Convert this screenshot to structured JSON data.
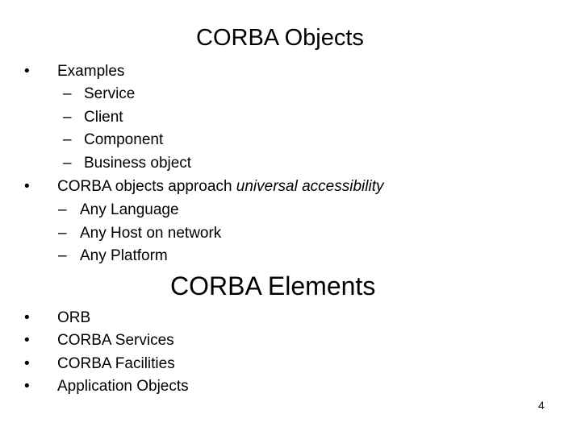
{
  "slide": {
    "title": "CORBA Objects",
    "objects_section": {
      "examples": {
        "label": "Examples",
        "items": [
          "Service",
          "Client",
          "Component",
          "Business object"
        ]
      },
      "accessibility": {
        "label_plain": "CORBA objects approach ",
        "label_italic": "universal accessibility",
        "items": [
          "Any Language",
          "Any Host on network",
          "Any Platform"
        ]
      }
    },
    "elements_title": "CORBA Elements",
    "elements": [
      "ORB",
      "CORBA Services",
      "CORBA Facilities",
      "Application Objects"
    ],
    "bullet_glyph": "•",
    "dash_glyph": "–",
    "page_number": "4"
  }
}
